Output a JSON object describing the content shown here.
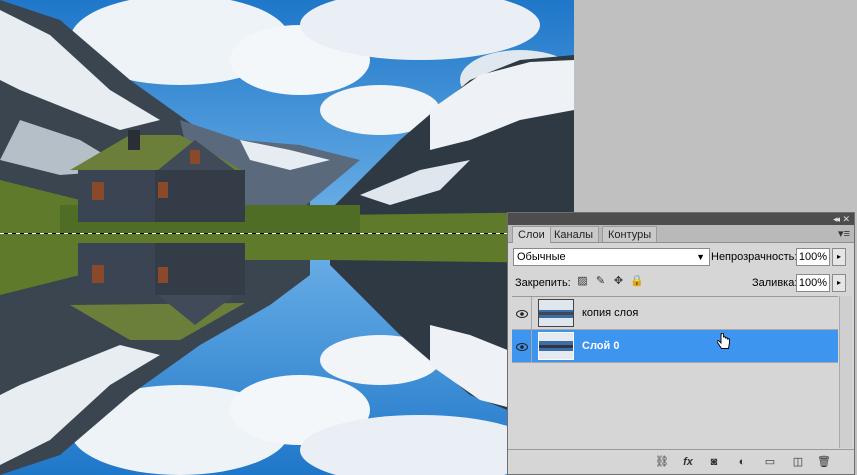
{
  "tabs": [
    {
      "label": "Слои",
      "active": true
    },
    {
      "label": "Каналы",
      "active": false
    },
    {
      "label": "Контуры",
      "active": false
    }
  ],
  "blend_mode": "Обычные",
  "opacity": {
    "label": "Непрозрачность:",
    "value": "100%"
  },
  "lock": {
    "label": "Закрепить:"
  },
  "fill": {
    "label": "Заливка:",
    "value": "100%"
  },
  "layers": [
    {
      "name": "копия слоя",
      "visible": true,
      "selected": false
    },
    {
      "name": "Слой 0",
      "visible": true,
      "selected": true
    }
  ],
  "colors": {
    "selection": "#3d95f0",
    "panel": "#d6d6d6",
    "workspace": "#c0c0c0"
  },
  "icons": [
    "link-icon",
    "fx-icon",
    "mask-icon",
    "adjustment-icon",
    "group-folder-icon",
    "new-layer-icon",
    "trash-icon"
  ]
}
